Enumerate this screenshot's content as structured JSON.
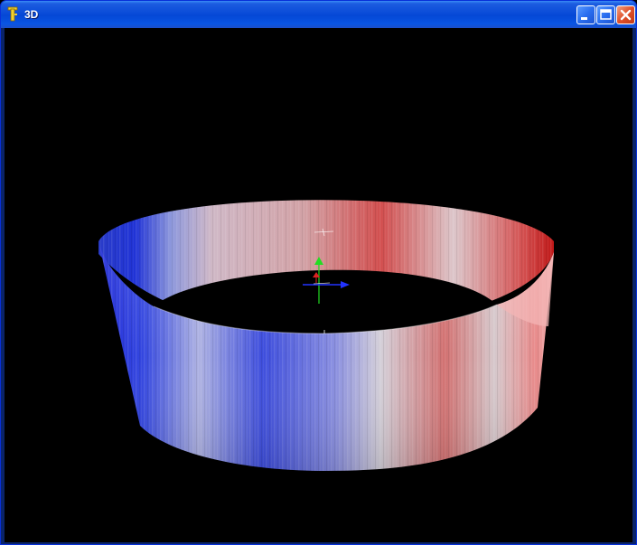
{
  "window": {
    "title": "3D",
    "app_icon": "yellow-tool-icon",
    "controls": [
      "minimize-icon",
      "maximize-icon",
      "close-icon"
    ]
  },
  "viewport": {
    "background": "#000000",
    "object": "cylindrical-band",
    "colormap": [
      "#1f2ad8",
      "#c8c8d6",
      "#d44444"
    ],
    "axes_colors": {
      "x": "#2233ff",
      "y": "#22dd22",
      "z": "#dd2222"
    }
  }
}
